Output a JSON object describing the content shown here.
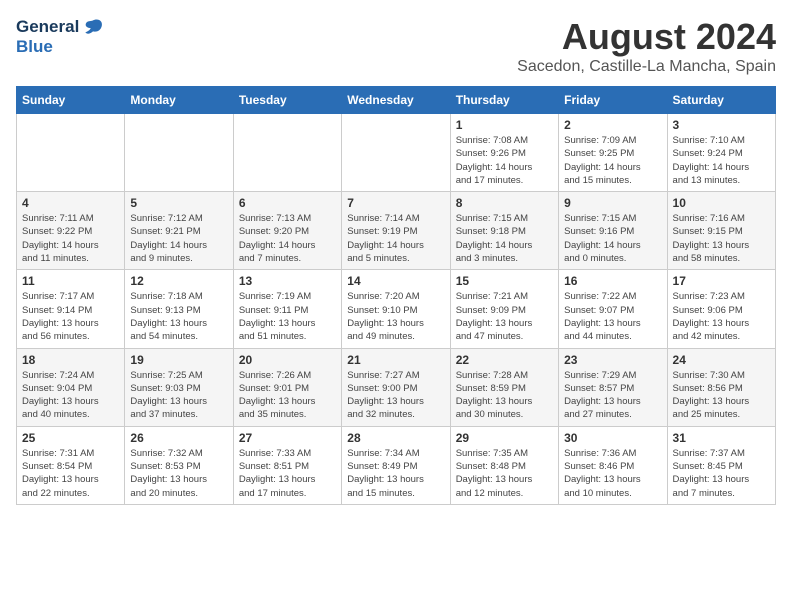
{
  "header": {
    "logo_line1": "General",
    "logo_line2": "Blue",
    "title": "August 2024",
    "subtitle": "Sacedon, Castille-La Mancha, Spain"
  },
  "weekdays": [
    "Sunday",
    "Monday",
    "Tuesday",
    "Wednesday",
    "Thursday",
    "Friday",
    "Saturday"
  ],
  "weeks": [
    [
      {
        "day": "",
        "info": ""
      },
      {
        "day": "",
        "info": ""
      },
      {
        "day": "",
        "info": ""
      },
      {
        "day": "",
        "info": ""
      },
      {
        "day": "1",
        "info": "Sunrise: 7:08 AM\nSunset: 9:26 PM\nDaylight: 14 hours\nand 17 minutes."
      },
      {
        "day": "2",
        "info": "Sunrise: 7:09 AM\nSunset: 9:25 PM\nDaylight: 14 hours\nand 15 minutes."
      },
      {
        "day": "3",
        "info": "Sunrise: 7:10 AM\nSunset: 9:24 PM\nDaylight: 14 hours\nand 13 minutes."
      }
    ],
    [
      {
        "day": "4",
        "info": "Sunrise: 7:11 AM\nSunset: 9:22 PM\nDaylight: 14 hours\nand 11 minutes."
      },
      {
        "day": "5",
        "info": "Sunrise: 7:12 AM\nSunset: 9:21 PM\nDaylight: 14 hours\nand 9 minutes."
      },
      {
        "day": "6",
        "info": "Sunrise: 7:13 AM\nSunset: 9:20 PM\nDaylight: 14 hours\nand 7 minutes."
      },
      {
        "day": "7",
        "info": "Sunrise: 7:14 AM\nSunset: 9:19 PM\nDaylight: 14 hours\nand 5 minutes."
      },
      {
        "day": "8",
        "info": "Sunrise: 7:15 AM\nSunset: 9:18 PM\nDaylight: 14 hours\nand 3 minutes."
      },
      {
        "day": "9",
        "info": "Sunrise: 7:15 AM\nSunset: 9:16 PM\nDaylight: 14 hours\nand 0 minutes."
      },
      {
        "day": "10",
        "info": "Sunrise: 7:16 AM\nSunset: 9:15 PM\nDaylight: 13 hours\nand 58 minutes."
      }
    ],
    [
      {
        "day": "11",
        "info": "Sunrise: 7:17 AM\nSunset: 9:14 PM\nDaylight: 13 hours\nand 56 minutes."
      },
      {
        "day": "12",
        "info": "Sunrise: 7:18 AM\nSunset: 9:13 PM\nDaylight: 13 hours\nand 54 minutes."
      },
      {
        "day": "13",
        "info": "Sunrise: 7:19 AM\nSunset: 9:11 PM\nDaylight: 13 hours\nand 51 minutes."
      },
      {
        "day": "14",
        "info": "Sunrise: 7:20 AM\nSunset: 9:10 PM\nDaylight: 13 hours\nand 49 minutes."
      },
      {
        "day": "15",
        "info": "Sunrise: 7:21 AM\nSunset: 9:09 PM\nDaylight: 13 hours\nand 47 minutes."
      },
      {
        "day": "16",
        "info": "Sunrise: 7:22 AM\nSunset: 9:07 PM\nDaylight: 13 hours\nand 44 minutes."
      },
      {
        "day": "17",
        "info": "Sunrise: 7:23 AM\nSunset: 9:06 PM\nDaylight: 13 hours\nand 42 minutes."
      }
    ],
    [
      {
        "day": "18",
        "info": "Sunrise: 7:24 AM\nSunset: 9:04 PM\nDaylight: 13 hours\nand 40 minutes."
      },
      {
        "day": "19",
        "info": "Sunrise: 7:25 AM\nSunset: 9:03 PM\nDaylight: 13 hours\nand 37 minutes."
      },
      {
        "day": "20",
        "info": "Sunrise: 7:26 AM\nSunset: 9:01 PM\nDaylight: 13 hours\nand 35 minutes."
      },
      {
        "day": "21",
        "info": "Sunrise: 7:27 AM\nSunset: 9:00 PM\nDaylight: 13 hours\nand 32 minutes."
      },
      {
        "day": "22",
        "info": "Sunrise: 7:28 AM\nSunset: 8:59 PM\nDaylight: 13 hours\nand 30 minutes."
      },
      {
        "day": "23",
        "info": "Sunrise: 7:29 AM\nSunset: 8:57 PM\nDaylight: 13 hours\nand 27 minutes."
      },
      {
        "day": "24",
        "info": "Sunrise: 7:30 AM\nSunset: 8:56 PM\nDaylight: 13 hours\nand 25 minutes."
      }
    ],
    [
      {
        "day": "25",
        "info": "Sunrise: 7:31 AM\nSunset: 8:54 PM\nDaylight: 13 hours\nand 22 minutes."
      },
      {
        "day": "26",
        "info": "Sunrise: 7:32 AM\nSunset: 8:53 PM\nDaylight: 13 hours\nand 20 minutes."
      },
      {
        "day": "27",
        "info": "Sunrise: 7:33 AM\nSunset: 8:51 PM\nDaylight: 13 hours\nand 17 minutes."
      },
      {
        "day": "28",
        "info": "Sunrise: 7:34 AM\nSunset: 8:49 PM\nDaylight: 13 hours\nand 15 minutes."
      },
      {
        "day": "29",
        "info": "Sunrise: 7:35 AM\nSunset: 8:48 PM\nDaylight: 13 hours\nand 12 minutes."
      },
      {
        "day": "30",
        "info": "Sunrise: 7:36 AM\nSunset: 8:46 PM\nDaylight: 13 hours\nand 10 minutes."
      },
      {
        "day": "31",
        "info": "Sunrise: 7:37 AM\nSunset: 8:45 PM\nDaylight: 13 hours\nand 7 minutes."
      }
    ]
  ]
}
